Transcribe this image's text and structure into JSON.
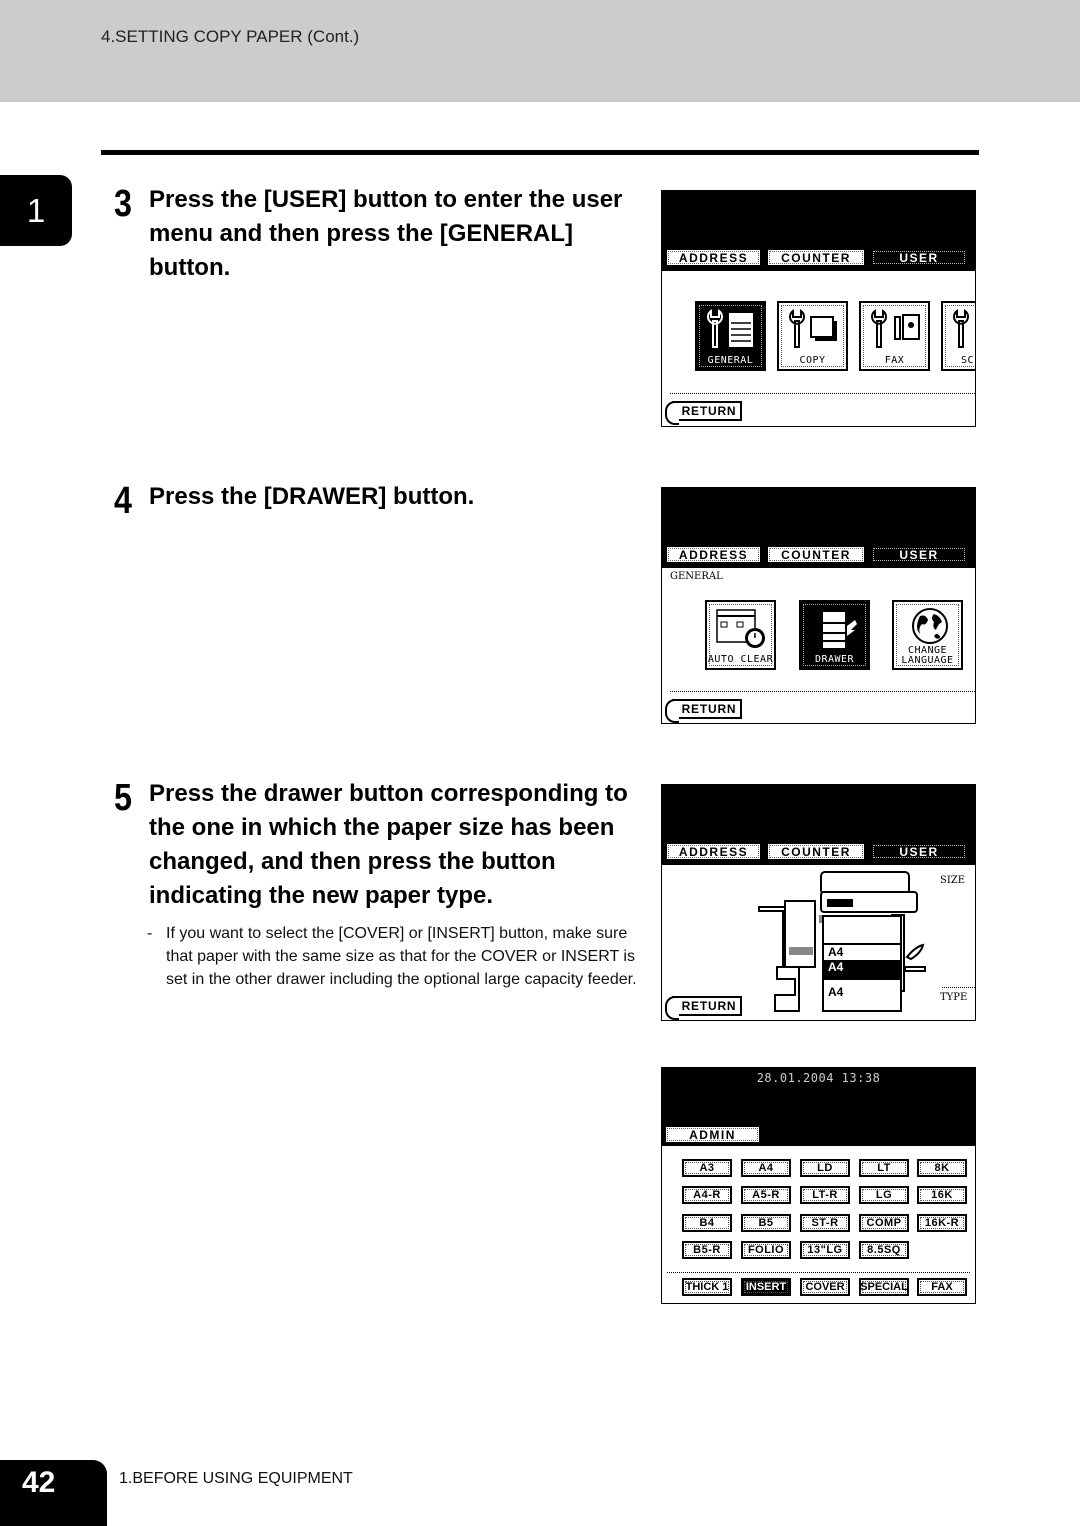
{
  "header": {
    "title": "4.SETTING COPY PAPER (Cont.)"
  },
  "chapter_tab": "1",
  "steps": [
    {
      "num": "3",
      "text": "Press the [USER] button to enter the user menu and then press the [GENERAL] button."
    },
    {
      "num": "4",
      "text": "Press the [DRAWER] button."
    },
    {
      "num": "5",
      "text": "Press the drawer button corresponding to the one in which the paper size has been changed, and then press the button indicating the new paper type.",
      "note_dash": "-",
      "note": "If you want to select the [COVER] or [INSERT] button, make sure that paper with the same size as that for the COVER or INSERT is set in the other drawer including the optional large capacity feeder."
    }
  ],
  "screens": {
    "tabs": [
      "ADDRESS",
      "COUNTER",
      "USER"
    ],
    "return_label": "RETURN",
    "user_menu": {
      "items": [
        {
          "label": "GENERAL",
          "icon": "wrench-copier-icon",
          "active": true
        },
        {
          "label": "COPY",
          "icon": "wrench-copy-icon",
          "active": false
        },
        {
          "label": "FAX",
          "icon": "wrench-fax-icon",
          "active": false
        },
        {
          "label": "SC",
          "icon": "wrench-scan-icon",
          "active": false
        }
      ]
    },
    "general_menu": {
      "title": "GENERAL",
      "items": [
        {
          "label": "AUTO CLEAR",
          "icon": "timer-icon",
          "active": false
        },
        {
          "label": "DRAWER",
          "icon": "drawer-icon",
          "active": true
        },
        {
          "label_line1": "CHANGE",
          "label_line2": "LANGUAGE",
          "icon": "globe-icon",
          "active": false
        }
      ]
    },
    "drawer_screen": {
      "size_label": "SIZE",
      "type_label": "TYPE",
      "drawers": [
        "A4",
        "A4",
        "A4"
      ],
      "selected_drawer": 2
    },
    "paper_screen": {
      "datetime": "28.01.2004 13:38",
      "admin_tab": "ADMIN",
      "sizes": [
        [
          "A3",
          "A4",
          "LD",
          "LT",
          "8K"
        ],
        [
          "A4-R",
          "A5-R",
          "LT-R",
          "LG",
          "16K"
        ],
        [
          "B4",
          "B5",
          "ST-R",
          "COMP",
          "16K-R"
        ],
        [
          "B5-R",
          "FOLIO",
          "13\"LG",
          "8.5SQ"
        ]
      ],
      "types": [
        "THICK 1",
        "INSERT",
        "COVER",
        "SPECIAL",
        "FAX"
      ],
      "selected_type": "INSERT"
    }
  },
  "footer": {
    "page_number": "42",
    "section": "1.BEFORE USING EQUIPMENT"
  }
}
